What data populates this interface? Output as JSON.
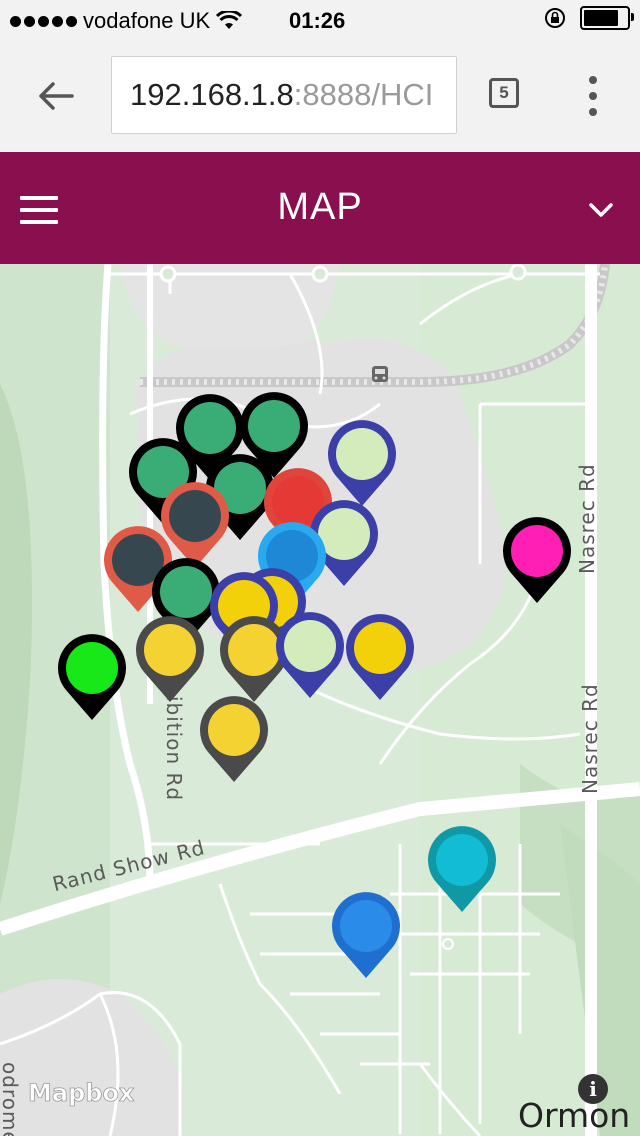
{
  "status_bar": {
    "carrier": "vodafone UK",
    "time": "01:26",
    "battery_level": 0.85,
    "signal_dots": 5
  },
  "browser": {
    "url_host": "192.168.1.8",
    "url_rest": ":8888/HCI",
    "tab_count": "5"
  },
  "app_header": {
    "title": "MAP"
  },
  "map": {
    "road_labels": {
      "rand_show": "Rand Show Rd",
      "nasrec_upper": "Nasrec Rd",
      "nasrec_lower": "Nasrec Rd",
      "exhibition": "ibition Rd",
      "partial_left": "odrome"
    },
    "place_label": "Ormon",
    "attribution": "Mapbox",
    "info_label": "i",
    "markers": [
      {
        "id": "m1",
        "border": "#000000",
        "fill": "#3aad77"
      },
      {
        "id": "m2",
        "border": "#000000",
        "fill": "#3aad77"
      },
      {
        "id": "m3",
        "border": "#000000",
        "fill": "#3aad77"
      },
      {
        "id": "m4",
        "border": "#000000",
        "fill": "#3aad77"
      },
      {
        "id": "m5",
        "border": "#3d3fa8",
        "fill": "#d4ecbc"
      },
      {
        "id": "m6",
        "border": "#e05a48",
        "fill": "#37474f"
      },
      {
        "id": "m7",
        "border": "#e0453c",
        "fill": "#e53935"
      },
      {
        "id": "m8",
        "border": "#3d3fa8",
        "fill": "#d4ecbc"
      },
      {
        "id": "m9",
        "border": "#e05a48",
        "fill": "#37474f"
      },
      {
        "id": "m10",
        "border": "#29a9f0",
        "fill": "#1e88d6"
      },
      {
        "id": "m11",
        "border": "#000000",
        "fill": "#3aad77"
      },
      {
        "id": "m12",
        "border": "#3d3fa8",
        "fill": "#f2d10a"
      },
      {
        "id": "m13",
        "border": "#3d3fa8",
        "fill": "#f2d10a"
      },
      {
        "id": "m14",
        "border": "#000000",
        "fill": "#ff1fb5"
      },
      {
        "id": "m15",
        "border": "#000000",
        "fill": "#17e817"
      },
      {
        "id": "m16",
        "border": "#4a4a4a",
        "fill": "#f4d232"
      },
      {
        "id": "m17",
        "border": "#4a4a4a",
        "fill": "#f4d232"
      },
      {
        "id": "m18",
        "border": "#3d3fa8",
        "fill": "#d4ecbc"
      },
      {
        "id": "m19",
        "border": "#3d3fa8",
        "fill": "#f2d10a"
      },
      {
        "id": "m20",
        "border": "#4a4a4a",
        "fill": "#f4d232"
      },
      {
        "id": "m21",
        "border": "#0f98a6",
        "fill": "#12bcd4"
      },
      {
        "id": "m22",
        "border": "#1f6fd1",
        "fill": "#2a8ce8"
      }
    ]
  }
}
